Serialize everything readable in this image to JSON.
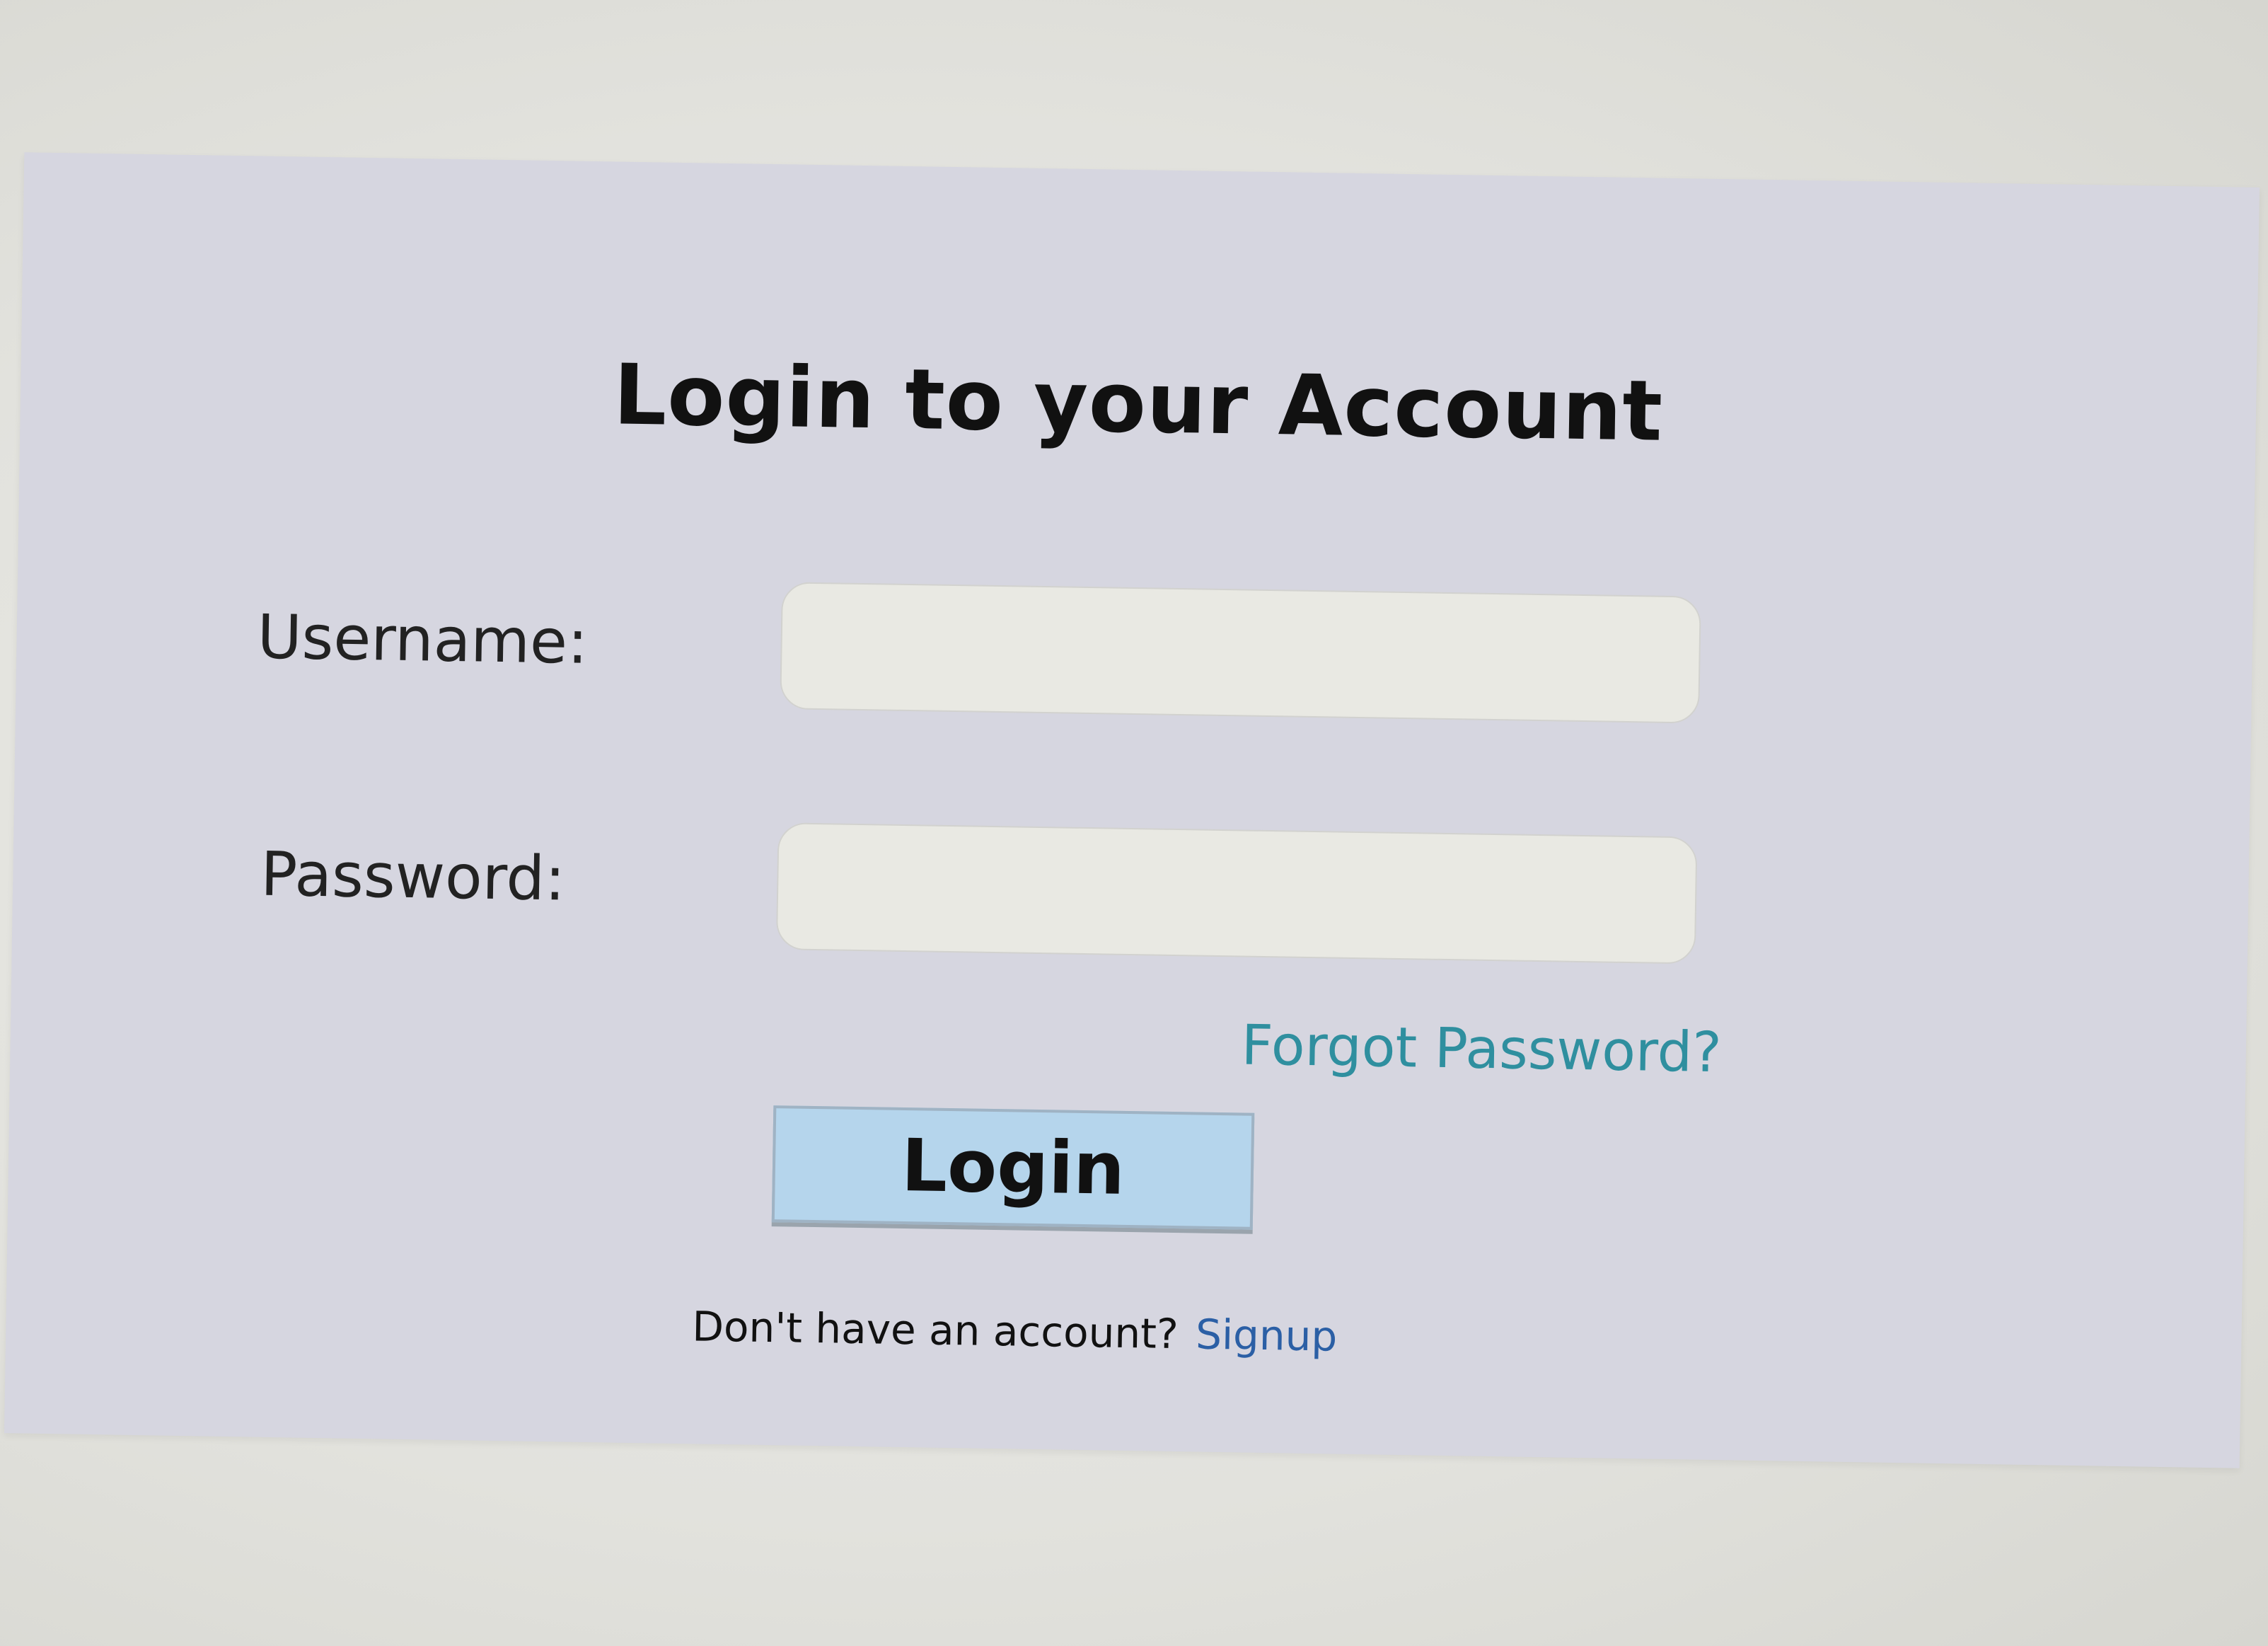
{
  "login": {
    "title": "Login to your Account",
    "username_label": "Username:",
    "username_value": "",
    "password_label": "Password:",
    "password_value": "",
    "forgot_password": "Forgot Password?",
    "login_button": "Login",
    "signup_prompt": "Don't have an account?",
    "signup_link": "Signup"
  },
  "colors": {
    "panel_background": "#d6d6e0",
    "input_background": "#e9e9e3",
    "button_background": "#b5d5ec",
    "forgot_link": "#2f8f9f",
    "signup_link": "#2b5fa5"
  }
}
